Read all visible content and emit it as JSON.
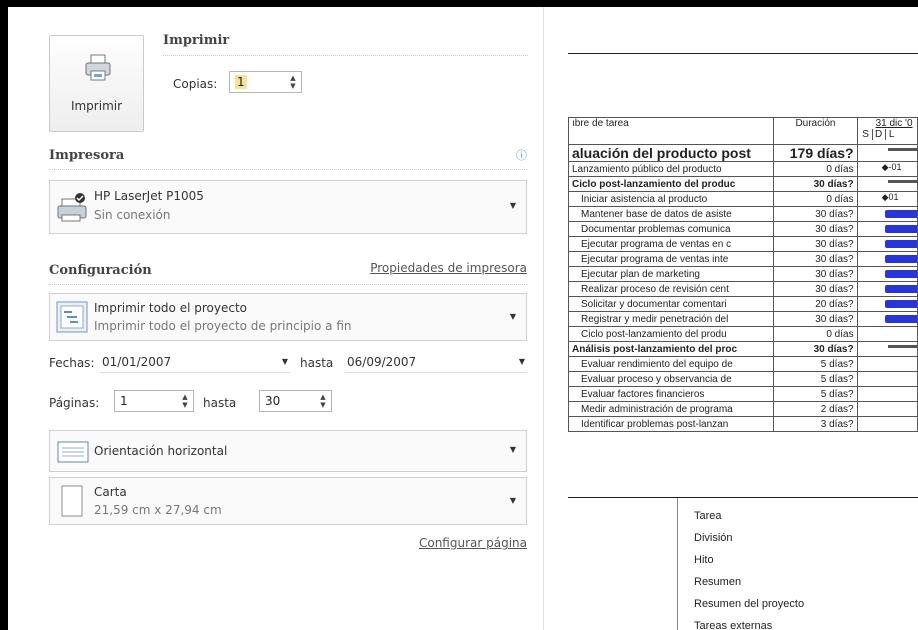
{
  "print": {
    "big_button_label": "Imprimir",
    "title": "Imprimir",
    "copies_label": "Copias:",
    "copies_value": "1"
  },
  "printer": {
    "heading": "Impresora",
    "name": "HP LaserJet P1005",
    "status": "Sin conexión",
    "properties_link": "Propiedades de impresora",
    "info_icon": "info-icon"
  },
  "settings": {
    "heading": "Configuración",
    "scope_title": "Imprimir todo el proyecto",
    "scope_desc": "Imprimir todo el proyecto de principio a fin",
    "dates_label": "Fechas:",
    "date_from": "01/01/2007",
    "date_to_label": "hasta",
    "date_to": "06/09/2007",
    "pages_label": "Páginas:",
    "page_from": "1",
    "page_to_label": "hasta",
    "page_to": "30",
    "orientation": "Orientación horizontal",
    "paper_name": "Carta",
    "paper_size": "21,59 cm x 27,94 cm",
    "page_setup_link": "Configurar página"
  },
  "preview": {
    "col_name": "ıbre de tarea",
    "col_duration": "Duración",
    "timeline_date": "31 dic '0",
    "timeline_days": [
      "S",
      "D",
      "L"
    ],
    "rows": [
      {
        "name": "aluación del producto post",
        "duration": "179 días?",
        "style": "big"
      },
      {
        "name": "Lanzamiento público del producto",
        "duration": "0 días",
        "style": "normal",
        "marker": "◆-01"
      },
      {
        "name": "Ciclo post-lanzamiento del produc",
        "duration": "30 días?",
        "style": "bold"
      },
      {
        "name": "Iniciar asistencia al producto",
        "duration": "0 días",
        "style": "normal",
        "marker": "◆01"
      },
      {
        "name": "Mantener base de datos de asiste",
        "duration": "30 días?",
        "style": "normal"
      },
      {
        "name": "Documentar problemas comunica",
        "duration": "30 días?",
        "style": "normal"
      },
      {
        "name": "Ejecutar programa de ventas en c",
        "duration": "30 días?",
        "style": "normal"
      },
      {
        "name": "Ejecutar programa de ventas inte",
        "duration": "30 días?",
        "style": "normal"
      },
      {
        "name": "Ejecutar plan de marketing",
        "duration": "30 días?",
        "style": "normal"
      },
      {
        "name": "Realizar proceso de revisión cent",
        "duration": "30 días?",
        "style": "normal"
      },
      {
        "name": "Solicitar y documentar comentari",
        "duration": "20 días?",
        "style": "normal"
      },
      {
        "name": "Registrar y medir penetración del",
        "duration": "30 días?",
        "style": "normal"
      },
      {
        "name": "Ciclo post-lanzamiento del produ",
        "duration": "0 días",
        "style": "normal"
      },
      {
        "name": "Análisis post-lanzamiento del proc",
        "duration": "30 días?",
        "style": "bold"
      },
      {
        "name": "Evaluar rendimiento del equipo de",
        "duration": "5 días?",
        "style": "normal"
      },
      {
        "name": "Evaluar proceso y observancia de",
        "duration": "5 días?",
        "style": "normal"
      },
      {
        "name": "Evaluar factores financieros",
        "duration": "5 días?",
        "style": "normal"
      },
      {
        "name": "Medir administración de programa",
        "duration": "2 días?",
        "style": "normal"
      },
      {
        "name": "Identificar problemas post-lanzan",
        "duration": "3 días?",
        "style": "normal"
      }
    ],
    "legend": [
      "Tarea",
      "División",
      "Hito",
      "Resumen",
      "Resumen del proyecto",
      "Tareas externas"
    ],
    "bar_color": "#2a35d9"
  }
}
